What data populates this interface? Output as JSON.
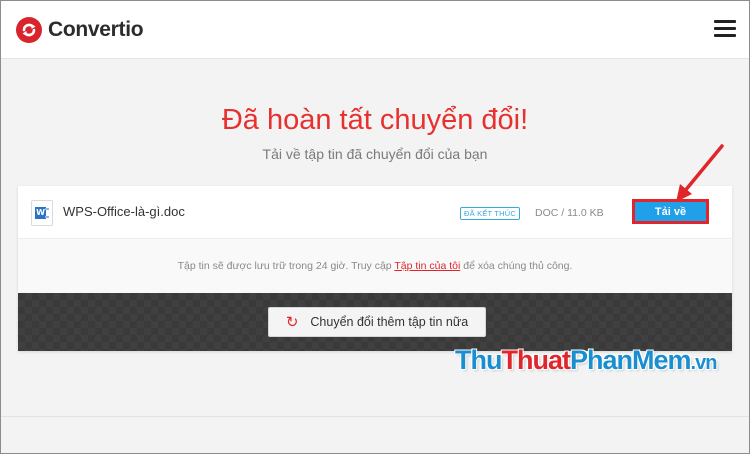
{
  "header": {
    "logo_text": "Convertio",
    "menu_icon": "hamburger-menu-icon"
  },
  "main": {
    "title": "Đã hoàn tất chuyển đổi!",
    "subtitle": "Tải về tập tin đã chuyển đổi của bạn"
  },
  "file": {
    "icon": "word-document-icon",
    "name": "WPS-Office-là-gì.doc",
    "status": "ĐÃ KẾT THÚC",
    "meta": "DOC / 11.0 KB",
    "download_label": "Tải về"
  },
  "note": {
    "before": "Tập tin sẽ được lưu trữ trong 24 giờ. Truy cập ",
    "link": "Tập tin của tôi",
    "after": " để xóa chúng thủ công."
  },
  "actions": {
    "convert_more_label": "Chuyển đổi thêm tập tin nữa",
    "convert_more_icon": "refresh-icon"
  },
  "watermark": {
    "part1": "Thu",
    "part2": "Thuat",
    "part3": "PhanMem",
    "part4": ".vn"
  },
  "colors": {
    "brand_red": "#e8312f",
    "download_blue": "#1fa0e8",
    "annotation_red": "#e0262b"
  }
}
